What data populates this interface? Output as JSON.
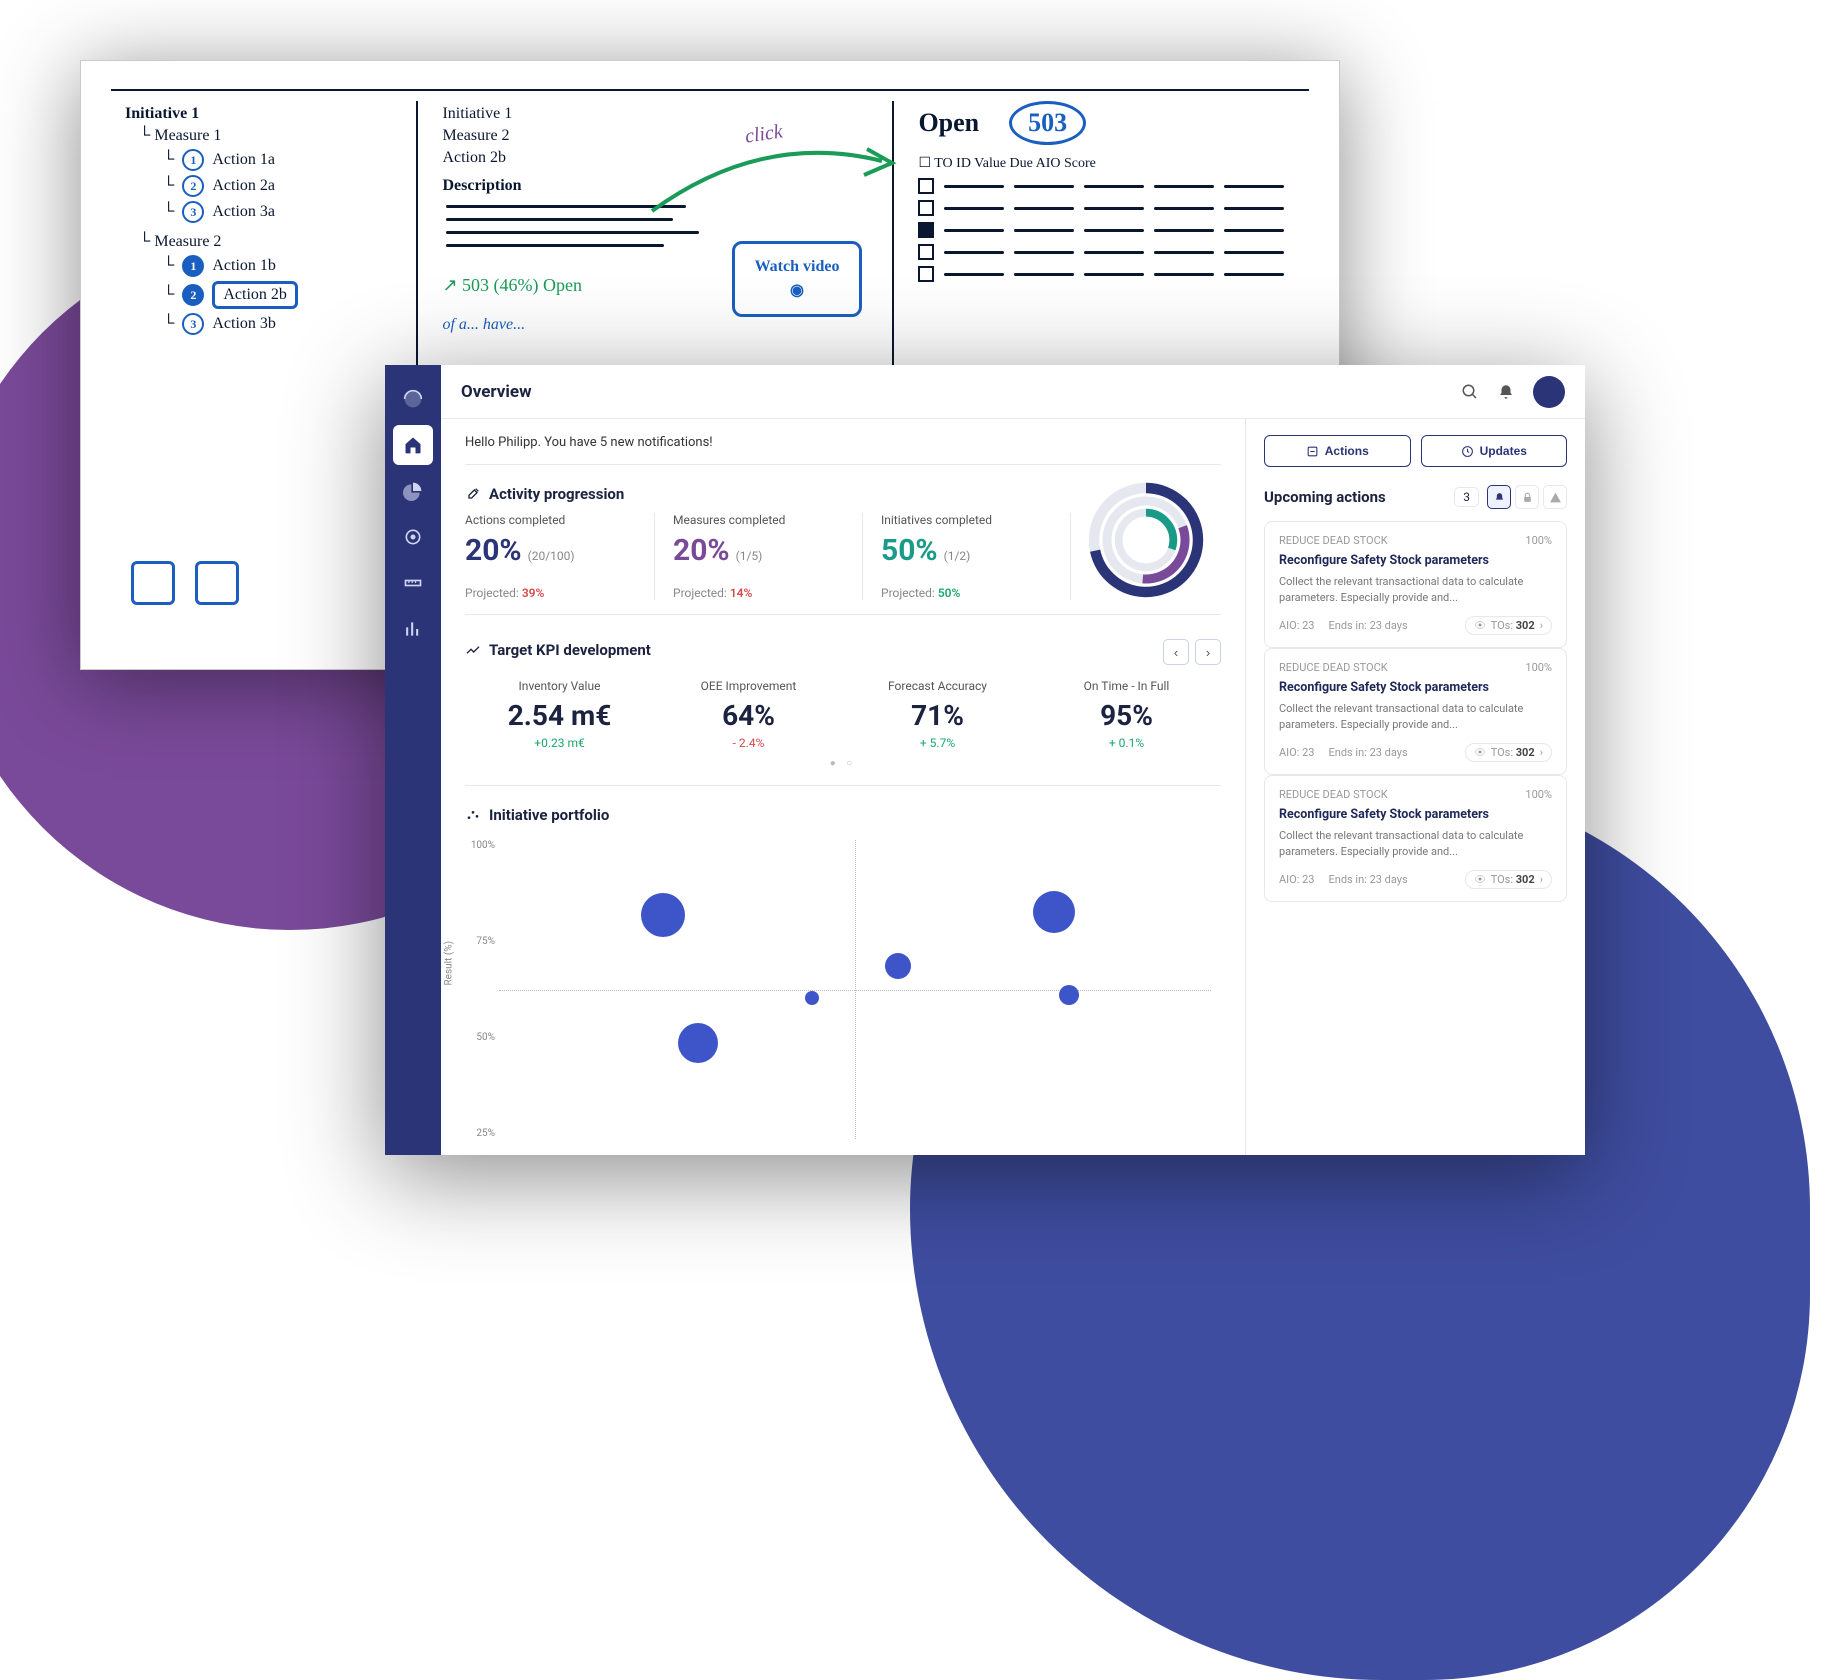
{
  "colors": {
    "navy": "#2b3476",
    "purple": "#7a4a9a",
    "teal": "#1a9b88",
    "green": "#1aa86b",
    "red": "#d64a4a",
    "blue": "#3d55c8"
  },
  "whiteboard": {
    "col1": {
      "title": "Initiative 1",
      "measure1": "Measure 1",
      "actions1": [
        "Action 1a",
        "Action 2a",
        "Action 3a"
      ],
      "measure2": "Measure 2",
      "actions2": [
        "Action 1b",
        "Action 2b",
        "Action 3b"
      ]
    },
    "col2": {
      "lines": [
        "Initiative 1",
        "Measure 2",
        "Action 2b"
      ],
      "desc_label": "Description",
      "open_stat": "503 (46%) Open",
      "box_label": "Watch video",
      "annotation": "click"
    },
    "col3": {
      "title": "Open",
      "count": "503",
      "columns": "☐  TO  ID  Value  Due  AIO Score"
    },
    "footer_note": "of a... have..."
  },
  "app": {
    "title": "Overview",
    "greeting": "Hello Philipp. You have 5 new notifications!",
    "activity": {
      "heading": "Activity progression",
      "cols": [
        {
          "label": "Actions completed",
          "pct": "20%",
          "sub": "(20/100)",
          "proj_label": "Projected:",
          "proj": "39%",
          "proj_class": "r"
        },
        {
          "label": "Measures completed",
          "pct": "20%",
          "sub": "(1/5)",
          "proj_label": "Projected:",
          "proj": "14%",
          "proj_class": "r"
        },
        {
          "label": "Initiatives completed",
          "pct": "50%",
          "sub": "(1/2)",
          "proj_label": "Projected:",
          "proj": "50%",
          "proj_class": "g"
        }
      ]
    },
    "kpi": {
      "heading": "Target KPI development",
      "items": [
        {
          "label": "Inventory Value",
          "val": "2.54 m€",
          "delta": "+0.23 m€",
          "dir": "up"
        },
        {
          "label": "OEE Improvement",
          "val": "64%",
          "delta": "- 2.4%",
          "dir": "down"
        },
        {
          "label": "Forecast Accuracy",
          "val": "71%",
          "delta": "+ 5.7%",
          "dir": "up"
        },
        {
          "label": "On Time - In Full",
          "val": "95%",
          "delta": "+ 0.1%",
          "dir": "up"
        }
      ]
    },
    "portfolio": {
      "heading": "Initiative portfolio",
      "y_title": "Result (%)",
      "y_ticks": [
        "100%",
        "75%",
        "50%",
        "25%"
      ]
    },
    "right": {
      "actions_btn": "Actions",
      "updates_btn": "Updates",
      "upcoming_heading": "Upcoming actions",
      "upcoming_count": "3",
      "cards": [
        {
          "tag": "REDUCE DEAD STOCK",
          "pct": "100%",
          "title": "Reconfigure Safety Stock parameters",
          "desc": "Collect the relevant transactional data to calculate parameters. Especially provide and...",
          "aio": "AIO: 23",
          "ends": "Ends in: 23 days",
          "tos_label": "TOs:",
          "tos": "302"
        },
        {
          "tag": "REDUCE DEAD STOCK",
          "pct": "100%",
          "title": "Reconfigure Safety Stock parameters",
          "desc": "Collect the relevant transactional data to calculate parameters. Especially provide and...",
          "aio": "AIO: 23",
          "ends": "Ends in: 23 days",
          "tos_label": "TOs:",
          "tos": "302"
        },
        {
          "tag": "REDUCE DEAD STOCK",
          "pct": "100%",
          "title": "Reconfigure Safety Stock parameters",
          "desc": "Collect the relevant transactional data to calculate parameters. Especially provide and...",
          "aio": "AIO: 23",
          "ends": "Ends in: 23 days",
          "tos_label": "TOs:",
          "tos": "302"
        }
      ]
    }
  },
  "chart_data": {
    "type": "scatter",
    "title": "Initiative portfolio",
    "ylabel": "Result (%)",
    "ylim": [
      0,
      100
    ],
    "xlim": [
      0,
      100
    ],
    "series": [
      {
        "name": "Initiatives",
        "points": [
          {
            "x": 23,
            "y": 75,
            "size": 44
          },
          {
            "x": 28,
            "y": 32,
            "size": 40
          },
          {
            "x": 44,
            "y": 47,
            "size": 14
          },
          {
            "x": 56,
            "y": 58,
            "size": 26
          },
          {
            "x": 78,
            "y": 76,
            "size": 42
          },
          {
            "x": 80,
            "y": 48,
            "size": 20
          }
        ]
      }
    ]
  }
}
